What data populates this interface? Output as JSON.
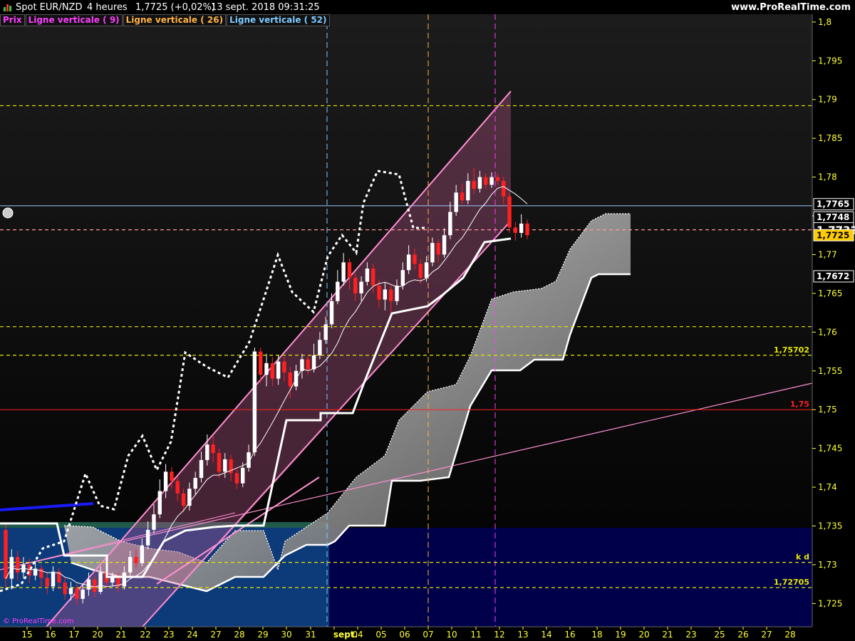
{
  "header": {
    "symbol": "Spot EUR/NZD",
    "timeframe": "4 heures",
    "price": "1,7725 (+0,02%)",
    "datetime": "13 sept. 2018 09:31:25",
    "brand": "www.ProRealTime.com",
    "watermark": "© ProRealTime.com"
  },
  "legend": [
    {
      "label": "Prix",
      "color": "#ff3dff"
    },
    {
      "label": "Ligne verticale ( 9)",
      "color": "#ff3dff"
    },
    {
      "label": "Ligne verticale ( 26)",
      "color": "#ffb347"
    },
    {
      "label": "Ligne verticale ( 52)",
      "color": "#7ecbff"
    }
  ],
  "colors": {
    "background": "#000000",
    "axis_text_yellow": "#ffff33",
    "channel_pink": "#ff8fd0",
    "level_red": "#ff2020",
    "candle_up": "#ffffff",
    "candle_down": "#ff2020",
    "blue_zone": "#0d3a78",
    "navy_zone": "#00004a"
  },
  "chart_data": {
    "type": "candlestick",
    "ylim": [
      1.722,
      1.801
    ],
    "y_ticks": [
      "1,8",
      "1,795",
      "1,79",
      "1,785",
      "1,78",
      "1,775",
      "1,77",
      "1,765",
      "1,76",
      "1,755",
      "1,75",
      "1,745",
      "1,74",
      "1,735",
      "1,73",
      "1,725"
    ],
    "x_ticks": [
      "15",
      "16",
      "17",
      "20",
      "21",
      "22",
      "23",
      "24",
      "27",
      "28",
      "29",
      "30",
      "31",
      "sept.",
      "04",
      "05",
      "06",
      "07",
      "10",
      "11",
      "12",
      "13",
      "14",
      "16",
      "18",
      "19",
      "20",
      "21",
      "23",
      "25",
      "26",
      "27",
      "28"
    ],
    "price_tags": [
      {
        "label": "1,7765",
        "value": 1.7765
      },
      {
        "label": "1,7748",
        "value": 1.7748
      },
      {
        "label": "1,7732",
        "value": 1.7732
      },
      {
        "label": "1,7725",
        "value": 1.7725
      },
      {
        "label": "1,7672",
        "value": 1.7672
      }
    ],
    "levels": [
      {
        "value": 1.7892,
        "label": "",
        "color": "#e6e600",
        "style": "dashed"
      },
      {
        "value": 1.7607,
        "label": "",
        "color": "#e6e600",
        "style": "dashed"
      },
      {
        "value": 1.75702,
        "label": "1,75702",
        "color": "#e6e600",
        "style": "dashed"
      },
      {
        "value": 1.75,
        "label": "1,75",
        "color": "#ff2020",
        "style": "solid"
      },
      {
        "value": 1.7303,
        "label": "k d",
        "color": "#e6e600",
        "style": "dashed"
      },
      {
        "value": 1.72705,
        "label": "1,72705",
        "color": "#e6e600",
        "style": "dashed"
      },
      {
        "value": 1.7732,
        "label": "",
        "color": "#ff9999",
        "style": "dashed"
      },
      {
        "value": 1.7763,
        "label": "",
        "color": "#9fc9ff",
        "style": "solid"
      }
    ],
    "candles": [
      [
        1.7345,
        1.7282,
        1.7355,
        1.727
      ],
      [
        1.7282,
        1.731,
        1.732,
        1.7268
      ],
      [
        1.731,
        1.729,
        1.7318,
        1.728
      ],
      [
        1.729,
        1.73,
        1.731,
        1.7282
      ],
      [
        1.73,
        1.7286,
        1.7308,
        1.7276
      ],
      [
        1.7286,
        1.7295,
        1.7304,
        1.728
      ],
      [
        1.7295,
        1.7283,
        1.73,
        1.727
      ],
      [
        1.7283,
        1.7272,
        1.729,
        1.7262
      ],
      [
        1.7272,
        1.7291,
        1.7298,
        1.7266
      ],
      [
        1.7291,
        1.7277,
        1.7296,
        1.7268
      ],
      [
        1.7277,
        1.7262,
        1.7284,
        1.7255
      ],
      [
        1.7262,
        1.727,
        1.7278,
        1.7254
      ],
      [
        1.727,
        1.7256,
        1.7276,
        1.7248
      ],
      [
        1.7256,
        1.7268,
        1.7276,
        1.725
      ],
      [
        1.7268,
        1.7281,
        1.729,
        1.726
      ],
      [
        1.7281,
        1.7265,
        1.7286,
        1.7258
      ],
      [
        1.7265,
        1.729,
        1.7298,
        1.7262
      ],
      [
        1.729,
        1.7277,
        1.7296,
        1.727
      ],
      [
        1.7277,
        1.7283,
        1.729,
        1.7272
      ],
      [
        1.7283,
        1.7272,
        1.729,
        1.7264
      ],
      [
        1.7272,
        1.729,
        1.7298,
        1.7268
      ],
      [
        1.729,
        1.731,
        1.7318,
        1.7286
      ],
      [
        1.731,
        1.7302,
        1.732,
        1.7296
      ],
      [
        1.7302,
        1.7325,
        1.7334,
        1.7298
      ],
      [
        1.7325,
        1.7345,
        1.7356,
        1.732
      ],
      [
        1.7345,
        1.7365,
        1.7378,
        1.734
      ],
      [
        1.7365,
        1.7395,
        1.741,
        1.736
      ],
      [
        1.7395,
        1.742,
        1.743,
        1.7386
      ],
      [
        1.742,
        1.7408,
        1.7426,
        1.7398
      ],
      [
        1.7408,
        1.7392,
        1.7414,
        1.7382
      ],
      [
        1.7392,
        1.7376,
        1.7398,
        1.7368
      ],
      [
        1.7376,
        1.7398,
        1.7406,
        1.737
      ],
      [
        1.7398,
        1.7412,
        1.742,
        1.739
      ],
      [
        1.7412,
        1.7435,
        1.7446,
        1.7406
      ],
      [
        1.7435,
        1.7455,
        1.7468,
        1.7428
      ],
      [
        1.7455,
        1.7444,
        1.7466,
        1.7432
      ],
      [
        1.7444,
        1.742,
        1.745,
        1.7412
      ],
      [
        1.742,
        1.7436,
        1.7444,
        1.7412
      ],
      [
        1.7436,
        1.7418,
        1.7442,
        1.7408
      ],
      [
        1.7418,
        1.7405,
        1.7424,
        1.7398
      ],
      [
        1.7405,
        1.7425,
        1.7432,
        1.74
      ],
      [
        1.7425,
        1.7445,
        1.7455,
        1.742
      ],
      [
        1.7445,
        1.7575,
        1.758,
        1.744
      ],
      [
        1.7575,
        1.7545,
        1.758,
        1.7535
      ],
      [
        1.7545,
        1.756,
        1.7572,
        1.753
      ],
      [
        1.756,
        1.754,
        1.7568,
        1.753
      ],
      [
        1.754,
        1.7562,
        1.757,
        1.7532
      ],
      [
        1.7562,
        1.7548,
        1.7568,
        1.7536
      ],
      [
        1.7548,
        1.753,
        1.7555,
        1.7515
      ],
      [
        1.753,
        1.755,
        1.7558,
        1.7525
      ],
      [
        1.755,
        1.7565,
        1.7572,
        1.754
      ],
      [
        1.7565,
        1.7552,
        1.757,
        1.7545
      ],
      [
        1.7552,
        1.757,
        1.7585,
        1.7548
      ],
      [
        1.757,
        1.759,
        1.76,
        1.7565
      ],
      [
        1.759,
        1.761,
        1.762,
        1.7585
      ],
      [
        1.761,
        1.764,
        1.765,
        1.7605
      ],
      [
        1.764,
        1.7665,
        1.768,
        1.7636
      ],
      [
        1.7665,
        1.769,
        1.7702,
        1.766
      ],
      [
        1.769,
        1.767,
        1.7695,
        1.7655
      ],
      [
        1.767,
        1.765,
        1.7676,
        1.764
      ],
      [
        1.765,
        1.7665,
        1.7672,
        1.764
      ],
      [
        1.7665,
        1.7682,
        1.769,
        1.766
      ],
      [
        1.7682,
        1.766,
        1.7688,
        1.765
      ],
      [
        1.766,
        1.7642,
        1.7668,
        1.7632
      ],
      [
        1.7642,
        1.7655,
        1.7664,
        1.7628
      ],
      [
        1.7655,
        1.764,
        1.7662,
        1.7625
      ],
      [
        1.764,
        1.766,
        1.7668,
        1.7635
      ],
      [
        1.766,
        1.768,
        1.769,
        1.7655
      ],
      [
        1.768,
        1.77,
        1.7712,
        1.7675
      ],
      [
        1.77,
        1.7688,
        1.7708,
        1.768
      ],
      [
        1.7688,
        1.767,
        1.7694,
        1.7662
      ],
      [
        1.767,
        1.769,
        1.7698,
        1.7665
      ],
      [
        1.769,
        1.7715,
        1.7722,
        1.7685
      ],
      [
        1.7715,
        1.77,
        1.772,
        1.769
      ],
      [
        1.77,
        1.7725,
        1.7734,
        1.7696
      ],
      [
        1.7725,
        1.7755,
        1.7768,
        1.772
      ],
      [
        1.7755,
        1.778,
        1.779,
        1.775
      ],
      [
        1.778,
        1.777,
        1.7792,
        1.7765
      ],
      [
        1.777,
        1.7795,
        1.7805,
        1.7765
      ],
      [
        1.7795,
        1.7785,
        1.7812,
        1.7778
      ],
      [
        1.7785,
        1.78,
        1.7808,
        1.778
      ],
      [
        1.78,
        1.779,
        1.7805,
        1.7784
      ],
      [
        1.779,
        1.78,
        1.7806,
        1.7786
      ],
      [
        1.78,
        1.7795,
        1.7804,
        1.779
      ],
      [
        1.7795,
        1.7775,
        1.78,
        1.7765
      ],
      [
        1.7775,
        1.7735,
        1.778,
        1.7728
      ],
      [
        1.7735,
        1.7728,
        1.7742,
        1.7718
      ],
      [
        1.7728,
        1.774,
        1.7752,
        1.7722
      ],
      [
        1.774,
        1.7725,
        1.7745,
        1.772
      ]
    ]
  }
}
